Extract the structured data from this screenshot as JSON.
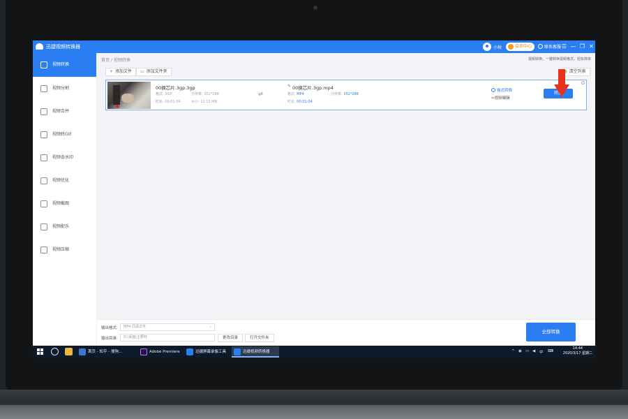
{
  "app": {
    "title": "迅捷视频转换器",
    "user_name": "小秋",
    "vip_label": "会员中心",
    "contact_label": "联系客服",
    "window_controls": [
      "☰",
      "—",
      "❐",
      "✕"
    ]
  },
  "sidebar": {
    "items": [
      {
        "label": "视频转换",
        "icon": "convert-icon",
        "active": true
      },
      {
        "label": "视频分割",
        "icon": "split-icon",
        "active": false
      },
      {
        "label": "视频合并",
        "icon": "merge-icon",
        "active": false
      },
      {
        "label": "视频转GIF",
        "icon": "gif-icon",
        "active": false
      },
      {
        "label": "视频去水印",
        "icon": "watermark-icon",
        "active": false
      },
      {
        "label": "视频优化",
        "icon": "optimize-icon",
        "active": false
      },
      {
        "label": "视频截图",
        "icon": "screenshot-icon",
        "active": false
      },
      {
        "label": "视频配乐",
        "icon": "music-icon",
        "active": false
      },
      {
        "label": "视频压缩",
        "icon": "compress-icon",
        "active": false
      }
    ]
  },
  "main": {
    "breadcrumb": "首页 / 视频转换",
    "slogan": "视频转换，一键转换视频格式，轻松简单",
    "add_file": "添加文件",
    "add_folder": "添加文件夹",
    "clear_list": "清空列表"
  },
  "file": {
    "source_name": "00换芯片.3gp.3gp",
    "source_format_label": "格式:",
    "source_format": "3GP",
    "source_resolution_label": "分辨率:",
    "source_resolution": "352*288",
    "source_duration_label": "时长:",
    "source_duration": "00:01:04",
    "source_size_label": "大小:",
    "source_size": "12.13 MB",
    "target_name": "00换芯片.3gp.mp4",
    "target_format_label": "格式:",
    "target_format": "MP4",
    "target_resolution_label": "分辨率:",
    "target_resolution": "352*288",
    "target_duration_label": "时长:",
    "target_duration": "00:01:04",
    "action_format": "格式转换",
    "action_edit": "视频编辑",
    "convert_button": "转换"
  },
  "bottom": {
    "output_format_label": "输出格式:",
    "output_format_value": "MP4  同源文件",
    "output_dir_label": "输出目录:",
    "output_dir_value": "D:\\桌面\\主要材",
    "change_dir": "更改目录",
    "open_folder": "打开文件夹",
    "convert_all": "全部转换"
  },
  "taskbar": {
    "apps": [
      {
        "label": "首页 - 知乎 - 搜狗...",
        "color": "#3a78c9",
        "active": false
      },
      {
        "label": "Adobe Premiere ...",
        "color": "#2a0f4f",
        "active": false
      },
      {
        "label": "迅捷屏幕录像工具",
        "color": "#2b7df2",
        "active": false
      },
      {
        "label": "迅捷视频转换器",
        "color": "#2b7df2",
        "active": true
      }
    ],
    "ime": "中",
    "time": "14:44",
    "date": "2020/3/17 星期二"
  },
  "colors": {
    "accent": "#2b7df2",
    "arrow": "#e8311b"
  }
}
